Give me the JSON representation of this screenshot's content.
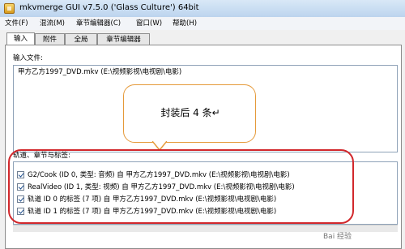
{
  "window": {
    "title": "mkvmerge GUI v7.5.0 ('Glass Culture') 64bit"
  },
  "menu": [
    "文件(F)",
    "混流(M)",
    "章节编辑器(C)",
    "窗口(W)",
    "帮助(H)"
  ],
  "tabs": [
    "输入",
    "附件",
    "全局",
    "章节编辑器"
  ],
  "input_section": {
    "label": "输入文件:",
    "files": [
      "甲方乙方1997_DVD.mkv (E:\\视频影视\\电视剧\\电影)"
    ]
  },
  "callout": {
    "text": "封装后 4 条↵"
  },
  "tracks_section": {
    "label": "轨道、章节与标签:",
    "tracks": [
      "G2/Cook (ID 0, 类型: 音频) 自 甲方乙方1997_DVD.mkv (E:\\视频影视\\电视剧\\电影)",
      "RealVideo (ID 1, 类型: 视频) 自 甲方乙方1997_DVD.mkv (E:\\视频影视\\电视剧\\电影)",
      "轨道 ID 0 的标签 (7 项) 自 甲方乙方1997_DVD.mkv (E:\\视频影视\\电视剧\\电影)",
      "轨道 ID 1 的标签 (7 项) 自 甲方乙方1997_DVD.mkv (E:\\视频影视\\电视剧\\电影)"
    ]
  },
  "watermark": {
    "text": "Bai 经验"
  }
}
